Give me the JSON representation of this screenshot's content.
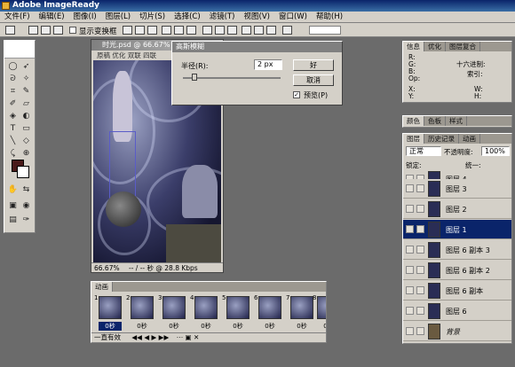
{
  "app": {
    "title": "Adobe ImageReady"
  },
  "menu": [
    "文件(F)",
    "编辑(E)",
    "图像(I)",
    "图层(L)",
    "切片(S)",
    "选择(C)",
    "滤镜(T)",
    "视图(V)",
    "窗口(W)",
    "帮助(H)"
  ],
  "options": {
    "show_transform": "显示变换框"
  },
  "document": {
    "title": "时光.psd @ 66.67% (彩底",
    "tabs": [
      "原稿",
      "优化",
      "双联",
      "四联"
    ],
    "zoom": "66.67%",
    "status": "-- / -- 秒 @ 28.8 Kbps"
  },
  "dialog": {
    "title": "高斯模糊",
    "radius_label": "半径(R):",
    "radius_value": "2",
    "radius_unit": "px",
    "ok": "好",
    "cancel": "取消",
    "preview": "预览(P)"
  },
  "info_panel": {
    "tabs": [
      "信息",
      "优化",
      "图层复合"
    ],
    "rgb": [
      "R:",
      "G:",
      "B:",
      "Op:"
    ],
    "hex_label": "十六进制:",
    "index_label": "索引:",
    "xy": [
      "X:",
      "Y:"
    ],
    "wh": [
      "W:",
      "H:"
    ]
  },
  "color_panel": {
    "tabs": [
      "颜色",
      "色板",
      "样式"
    ]
  },
  "layers_panel": {
    "tabs": [
      "图层",
      "历史记录",
      "动画"
    ],
    "blend_mode": "正常",
    "opacity_label": "不透明度:",
    "opacity": "100%",
    "lock_label": "锁定:",
    "unify_label": "统一:",
    "layers": [
      {
        "name": "图层 4"
      },
      {
        "name": "图层 3"
      },
      {
        "name": "图层 2"
      },
      {
        "name": "图层 1"
      },
      {
        "name": "图层 6 副本 3"
      },
      {
        "name": "图层 6 副本 2"
      },
      {
        "name": "图层 6 副本"
      },
      {
        "name": "图层 6"
      },
      {
        "name": "背景"
      }
    ],
    "selected_layer": "图层 1"
  },
  "animation_panel": {
    "title": "动画",
    "loop": "一直有效",
    "frames": [
      {
        "num": "1",
        "delay": "0秒"
      },
      {
        "num": "2",
        "delay": "0秒"
      },
      {
        "num": "3",
        "delay": "0秒"
      },
      {
        "num": "4",
        "delay": "0秒"
      },
      {
        "num": "5",
        "delay": "0秒"
      },
      {
        "num": "6",
        "delay": "0秒"
      },
      {
        "num": "7",
        "delay": "0秒"
      },
      {
        "num": "8",
        "delay": "0秒"
      }
    ]
  },
  "colors": {
    "title_active": "#0a246a",
    "panel_bg": "#d4d0c8",
    "workspace": "#6b6b6b",
    "foreground_color": "#4a1a1a"
  }
}
